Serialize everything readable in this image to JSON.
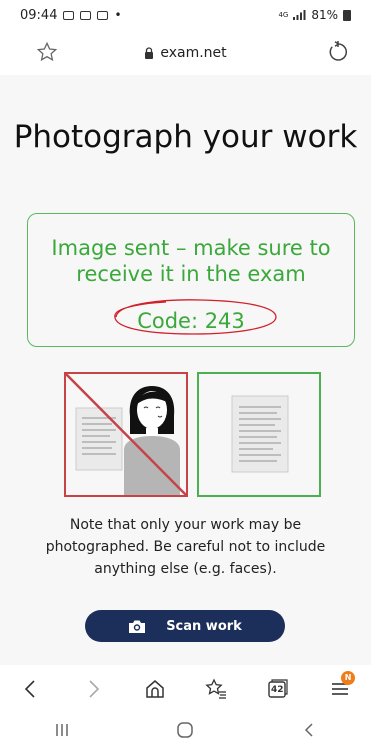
{
  "status_bar": {
    "time": "09:44",
    "dot": "•",
    "network": "4G",
    "battery": "81%"
  },
  "browser": {
    "url": "exam.net",
    "icons": [
      "star-icon",
      "lock-icon",
      "reload-icon"
    ]
  },
  "page": {
    "title": "Photograph your work",
    "sent_message": "Image sent – make sure to receive it in the exam",
    "code": "Code: 243",
    "note": "Note that only your work may be photographed. Be careful not to include anything else (e.g. faces).",
    "scan_button_label": "Scan work"
  },
  "bottom_nav": {
    "tab_count": "42",
    "notification_badge": "N",
    "icons": [
      "back-icon",
      "forward-icon",
      "home-icon",
      "bookmarks-icon",
      "tabs-icon",
      "menu-icon"
    ]
  },
  "colors": {
    "success_green": "#3aa83a",
    "error_red": "#c64347",
    "button_navy": "#1b2f5a",
    "badge_orange": "#f07d19"
  }
}
